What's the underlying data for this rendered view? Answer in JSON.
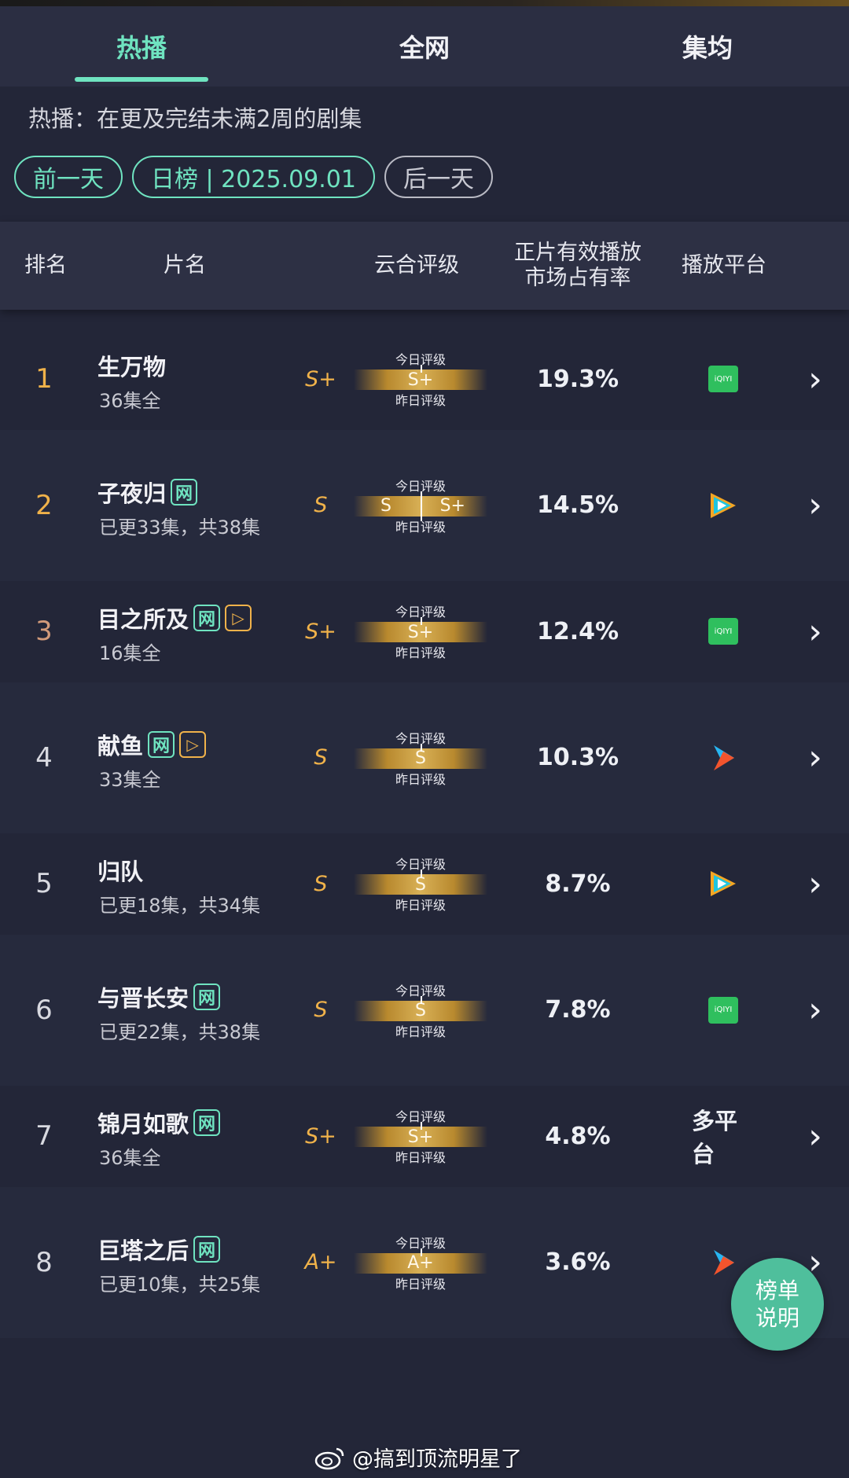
{
  "tabs": [
    {
      "label": "热播",
      "active": true
    },
    {
      "label": "全网",
      "active": false
    },
    {
      "label": "集均",
      "active": false
    }
  ],
  "subtitle": "热播：在更及完结未满2周的剧集",
  "date_nav": {
    "prev": "前一天",
    "current": "日榜 | 2025.09.01",
    "next": "后一天"
  },
  "columns": {
    "rank": "排名",
    "title": "片名",
    "grade": "云合评级",
    "share_line1": "正片有效播放",
    "share_line2": "市场占有率",
    "platform": "播放平台"
  },
  "gauge_labels": {
    "today": "今日评级",
    "yesterday": "昨日评级"
  },
  "rows": [
    {
      "rank": "1",
      "title": "生万物",
      "sub": "36集全",
      "grade": "S+",
      "gauge": "S+",
      "share": "19.3%",
      "platform": "iqiyi",
      "badges": []
    },
    {
      "rank": "2",
      "title": "子夜归",
      "sub": "已更33集，共38集",
      "grade": "S",
      "gauge_left": "S",
      "gauge_right": "S+",
      "share": "14.5%",
      "platform": "tencent-video",
      "badges": [
        "网"
      ]
    },
    {
      "rank": "3",
      "title": "目之所及",
      "sub": "16集全",
      "grade": "S+",
      "gauge": "S+",
      "share": "12.4%",
      "platform": "iqiyi",
      "badges": [
        "网",
        "▷"
      ]
    },
    {
      "rank": "4",
      "title": "献鱼",
      "sub": "33集全",
      "grade": "S",
      "gauge": "S",
      "share": "10.3%",
      "platform": "youku",
      "badges": [
        "网",
        "▷"
      ]
    },
    {
      "rank": "5",
      "title": "归队",
      "sub": "已更18集，共34集",
      "grade": "S",
      "gauge": "S",
      "share": "8.7%",
      "platform": "tencent-video",
      "badges": []
    },
    {
      "rank": "6",
      "title": "与晋长安",
      "sub": "已更22集，共38集",
      "grade": "S",
      "gauge": "S",
      "share": "7.8%",
      "platform": "iqiyi",
      "badges": [
        "网"
      ]
    },
    {
      "rank": "7",
      "title": "锦月如歌",
      "sub": "36集全",
      "grade": "S+",
      "gauge": "S+",
      "share": "4.8%",
      "platform": "多平台",
      "badges": [
        "网"
      ]
    },
    {
      "rank": "8",
      "title": "巨塔之后",
      "sub": "已更10集，共25集",
      "grade": "A+",
      "gauge": "A+",
      "share": "3.6%",
      "platform": "youku",
      "badges": [
        "网"
      ]
    }
  ],
  "iqiyi_logo_text": "iQIYI",
  "float_button": {
    "line1": "榜单",
    "line2": "说明"
  },
  "watermark_handle": "@搞到顶流明星了",
  "colors": {
    "accent": "#6fe3c0",
    "gold": "#f0b24a",
    "bg": "#232638"
  }
}
